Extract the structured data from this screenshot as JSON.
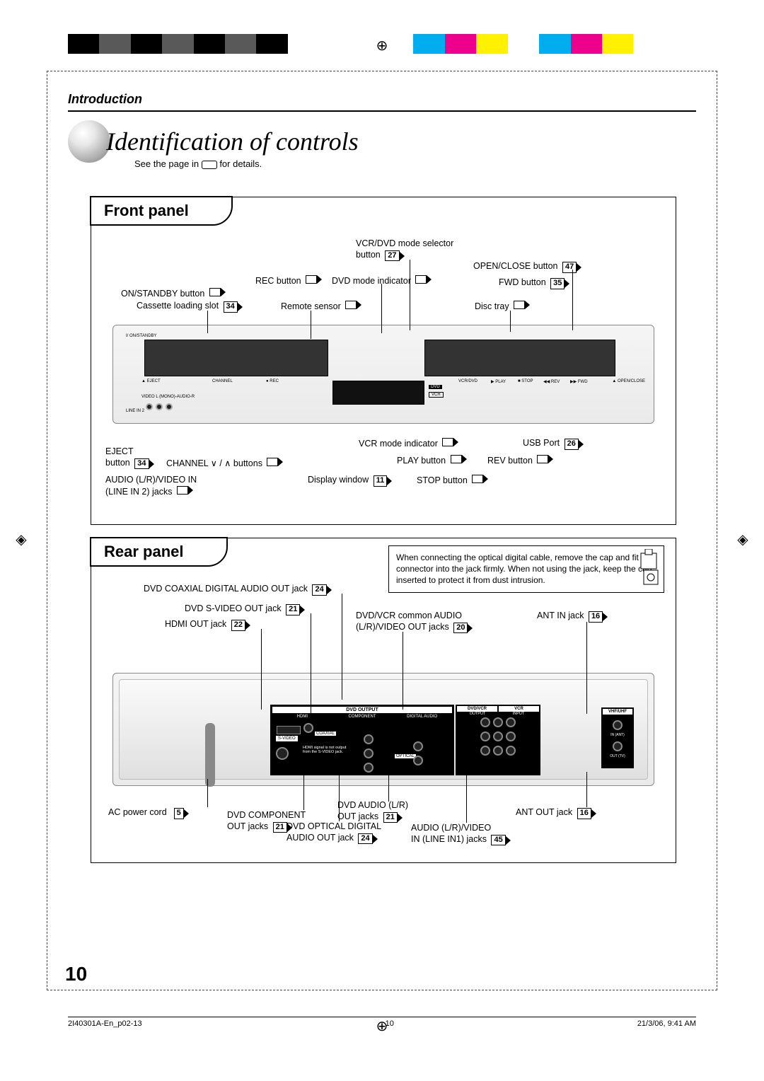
{
  "header": {
    "section": "Introduction"
  },
  "title": "Identification of controls",
  "subtitle_pre": "See the page in ",
  "subtitle_post": " for details.",
  "front": {
    "heading": "Front panel",
    "callouts": {
      "on_standby": "ON/STANDBY button",
      "cassette_slot": "Cassette loading slot",
      "cassette_slot_pg": "34",
      "rec": "REC button",
      "remote_sensor": "Remote sensor",
      "mode_selector": "VCR/DVD mode selector",
      "mode_selector2": "button",
      "mode_selector_pg": "27",
      "dvd_mode_ind": "DVD mode indicator",
      "open_close": "OPEN/CLOSE button",
      "open_close_pg": "47",
      "fwd": "FWD button",
      "fwd_pg": "35",
      "disc_tray": "Disc tray",
      "eject": "EJECT",
      "eject2": "button",
      "eject_pg": "34",
      "channel": "CHANNEL ∨ / ∧ buttons",
      "audio_in": "AUDIO (L/R)/VIDEO IN",
      "audio_in2": "(LINE IN 2) jacks",
      "display": "Display window",
      "display_pg": "11",
      "vcr_mode_ind": "VCR mode indicator",
      "usb": "USB Port",
      "usb_pg": "26",
      "play": "PLAY button",
      "rev": "REV button",
      "stop": "STOP button"
    },
    "device_tiny": {
      "standby": "I/  ON/STANDBY",
      "eject": "▲ EJECT",
      "channel": "CHANNEL",
      "rec": "● REC",
      "linein2": "LINE IN 2",
      "av": "VIDEO   L (MONO)-AUDIO-R",
      "vcrdvd": "VCR/DVD",
      "play": "▶ PLAY",
      "stop": "■ STOP",
      "rev": "◀◀ REV",
      "fwd": "▶▶ FWD",
      "openclose": "▲ OPEN/CLOSE",
      "dvd": "DVD",
      "vcr": "VCR"
    }
  },
  "rear": {
    "heading": "Rear panel",
    "note": "When connecting the optical digital cable, remove the cap and fit the connector into the jack firmly. When not using the jack, keep the cap inserted to protect it from dust intrusion.",
    "callouts": {
      "coax": "DVD COAXIAL DIGITAL AUDIO OUT jack",
      "coax_pg": "24",
      "svideo": "DVD S-VIDEO OUT jack",
      "svideo_pg": "21",
      "hdmi": "HDMI OUT jack",
      "hdmi_pg": "22",
      "common_av": "DVD/VCR common AUDIO",
      "common_av2": "(L/R)/VIDEO OUT jacks",
      "common_av_pg": "20",
      "ant_in": "ANT IN jack",
      "ant_in_pg": "16",
      "ac": "AC power cord",
      "ac_pg": "5",
      "component": "DVD COMPONENT",
      "component2": "OUT jacks",
      "component_pg": "21",
      "optical": "DVD OPTICAL DIGITAL",
      "optical2": "AUDIO OUT jack",
      "optical_pg": "24",
      "dvd_audio": "DVD AUDIO (L/R)",
      "dvd_audio2": "OUT jacks",
      "dvd_audio_pg": "21",
      "av_in": "AUDIO (L/R)/VIDEO",
      "av_in2": "IN (LINE IN1) jacks",
      "av_in_pg": "45",
      "ant_out": "ANT OUT jack",
      "ant_out_pg": "16"
    },
    "panel_labels": {
      "dvd_output": "DVD OUTPUT",
      "hdmi": "HDMI",
      "component": "COMPONENT",
      "digital": "DIGITAL AUDIO",
      "coaxial": "COAXIAL",
      "optical": "OPTICAL",
      "svideo": "S-VIDEO",
      "dvdvcr": "DVD/VCR",
      "vcr": "VCR",
      "output": "OUTPUT",
      "input": "INPUT",
      "vhfuhf": "VHF/UHF",
      "in": "IN (ANT)",
      "out": "OUT (TV)",
      "svideo_note": "HDMI signal is not output from the S-VIDEO jack."
    }
  },
  "page_number": "10",
  "footer": {
    "file": "2I40301A-En_p02-13",
    "pg": "10",
    "date": "21/3/06, 9:41 AM"
  },
  "colors": [
    "#000",
    "#5a5a5a",
    "#000",
    "#5a5a5a",
    "#000",
    "#5a5a5a",
    "#000",
    "#fff",
    "#fff",
    "#fff",
    "#fff",
    "#00aeef",
    "#ec008c",
    "#fff100",
    "#fff",
    "#00aeef",
    "#ec008c",
    "#fff100",
    "#fff",
    "#fff"
  ]
}
